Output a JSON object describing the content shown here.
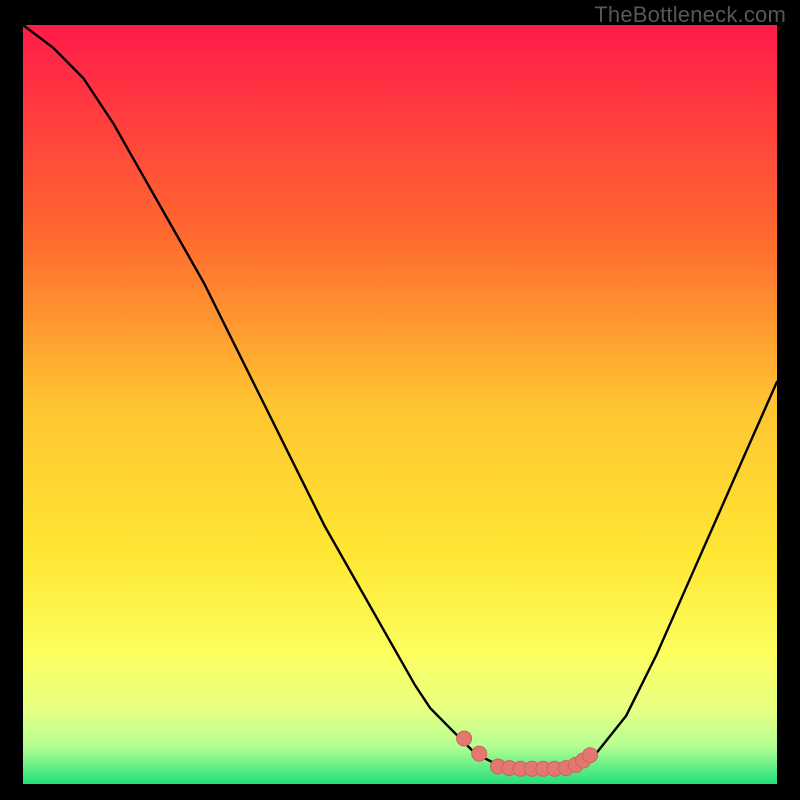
{
  "watermark": "TheBottleneck.com",
  "colors": {
    "bg": "#000000",
    "grad_top": "#ff1b4a",
    "grad_mid_hi": "#ff9a2a",
    "grad_mid": "#ffe733",
    "grad_low1": "#f6ff66",
    "grad_low2": "#d7ff7a",
    "grad_low3": "#8bff9e",
    "grad_bot": "#22e07a",
    "curve": "#000000",
    "dots": "#e2786f",
    "dots_stroke": "#d16258"
  },
  "chart_data": {
    "type": "line",
    "title": "",
    "xlabel": "",
    "ylabel": "",
    "xlim": [
      0,
      100
    ],
    "ylim": [
      0,
      100
    ],
    "series": [
      {
        "name": "bottleneck-curve",
        "x": [
          0,
          4,
          8,
          12,
          16,
          20,
          24,
          28,
          32,
          36,
          40,
          44,
          48,
          52,
          54,
          56,
          58,
          60,
          62,
          64,
          66,
          68,
          70,
          72,
          76,
          80,
          84,
          88,
          92,
          96,
          100
        ],
        "values": [
          100,
          97,
          93,
          87,
          80,
          73,
          66,
          58,
          50,
          42,
          34,
          27,
          20,
          13,
          10,
          8,
          6,
          4,
          3,
          2.2,
          2,
          2,
          2,
          2.3,
          4,
          9,
          17,
          26,
          35,
          44,
          53
        ]
      }
    ],
    "markers": [
      {
        "x": 58.5,
        "y": 6.0
      },
      {
        "x": 60.5,
        "y": 4.0
      },
      {
        "x": 63.0,
        "y": 2.3
      },
      {
        "x": 64.5,
        "y": 2.1
      },
      {
        "x": 66.0,
        "y": 2.0
      },
      {
        "x": 67.5,
        "y": 2.0
      },
      {
        "x": 69.0,
        "y": 2.0
      },
      {
        "x": 70.5,
        "y": 2.0
      },
      {
        "x": 72.0,
        "y": 2.1
      },
      {
        "x": 73.3,
        "y": 2.5
      },
      {
        "x": 74.3,
        "y": 3.1
      },
      {
        "x": 75.2,
        "y": 3.8
      }
    ]
  }
}
